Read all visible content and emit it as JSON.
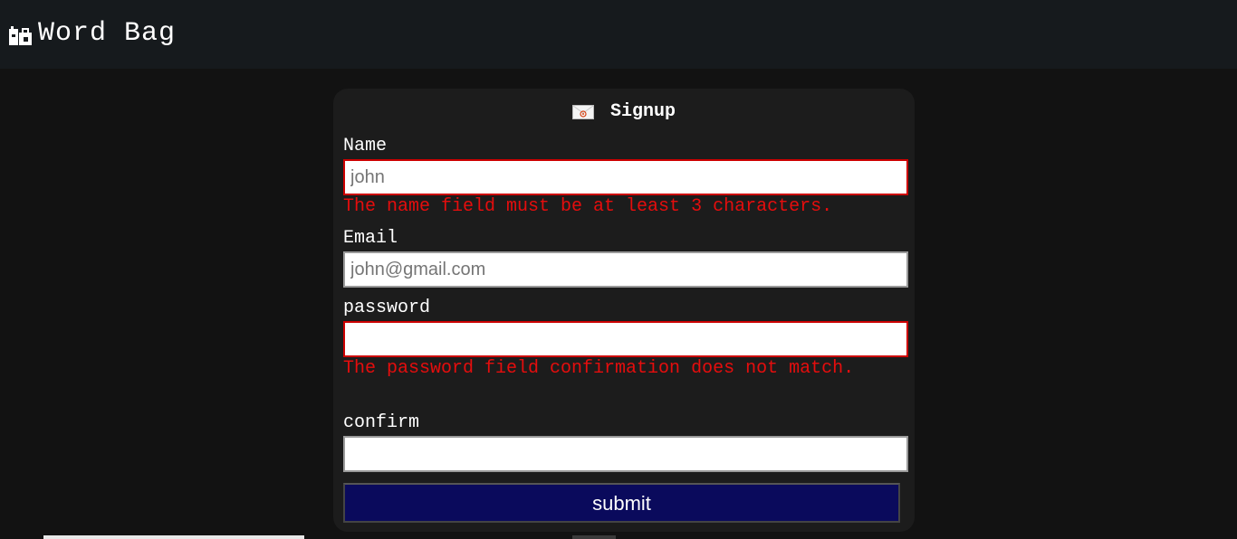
{
  "navbar": {
    "icon": "books-bag-icon",
    "title": "Word Bag"
  },
  "signup": {
    "icon": "envelope-icon",
    "title": "Signup",
    "name": {
      "label": "Name",
      "placeholder": "john",
      "value": "",
      "error": "The name field must be at least 3 characters."
    },
    "email": {
      "label": "Email",
      "placeholder": "john@gmail.com",
      "value": ""
    },
    "password": {
      "label": "password",
      "value": "",
      "error": "The password field confirmation does not match."
    },
    "confirm": {
      "label": "confirm",
      "value": ""
    },
    "submit_label": "submit"
  },
  "colors": {
    "background": "#121212",
    "navbar": "#161a1d",
    "card": "#1c1c1c",
    "error": "#e50d0d",
    "button": "#0a0a5c"
  }
}
